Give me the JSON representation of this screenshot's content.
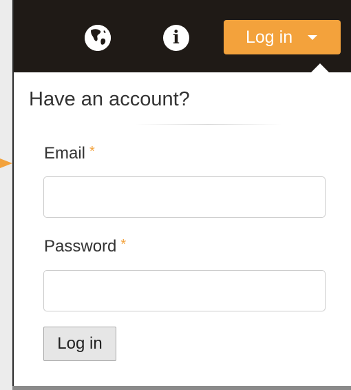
{
  "nav": {
    "globe_icon": "globe-icon",
    "info_icon": "info-icon",
    "info_glyph": "i",
    "login_dropdown_label": "Log in",
    "caret_icon": "chevron-down-icon"
  },
  "form": {
    "heading": "Have an account?",
    "email_label": "Email",
    "password_label": "Password",
    "required_marker": "*",
    "email_value": "",
    "password_value": "",
    "submit_label": "Log in"
  },
  "colors": {
    "accent": "#f3a23c",
    "topbar": "#1f1a16",
    "background": "#ffffff"
  }
}
